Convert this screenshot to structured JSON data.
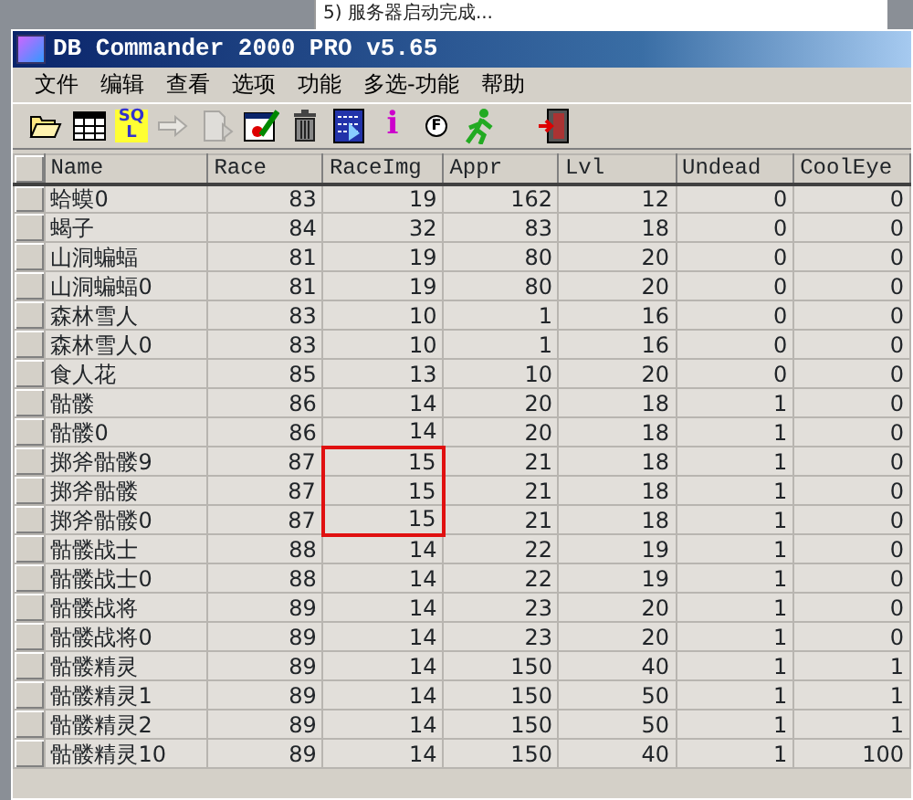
{
  "background_text": "5) 服务器启动完成...",
  "window": {
    "title": "DB Commander 2000 PRO v5.65"
  },
  "menu": [
    "文件",
    "编辑",
    "查看",
    "选项",
    "功能",
    "多选-功能",
    "帮助"
  ],
  "toolbar": [
    {
      "kind": "open",
      "disabled": false
    },
    {
      "kind": "table",
      "disabled": false
    },
    {
      "kind": "sql",
      "label": "SQL",
      "disabled": false
    },
    {
      "kind": "arrow",
      "disabled": true
    },
    {
      "kind": "export",
      "disabled": true
    },
    {
      "kind": "edit",
      "disabled": false
    },
    {
      "kind": "trash",
      "disabled": false
    },
    {
      "kind": "import",
      "disabled": false
    },
    {
      "kind": "info",
      "label": "i",
      "disabled": false
    },
    {
      "kind": "find",
      "label": "F",
      "disabled": false
    },
    {
      "kind": "run",
      "disabled": false
    },
    {
      "kind": "exit",
      "disabled": false
    }
  ],
  "table": {
    "columns": [
      "Name",
      "Race",
      "RaceImg",
      "Appr",
      "Lvl",
      "Undead",
      "CoolEye"
    ],
    "rows": [
      {
        "cells": [
          "蛤蟆0",
          "83",
          "19",
          "162",
          "12",
          "0",
          "0"
        ],
        "marked": false
      },
      {
        "cells": [
          "蝎子",
          "84",
          "32",
          "83",
          "18",
          "0",
          "0"
        ],
        "marked": false
      },
      {
        "cells": [
          "山洞蝙蝠",
          "81",
          "19",
          "80",
          "20",
          "0",
          "0"
        ],
        "marked": false
      },
      {
        "cells": [
          "山洞蝙蝠0",
          "81",
          "19",
          "80",
          "20",
          "0",
          "0"
        ],
        "marked": false
      },
      {
        "cells": [
          "森林雪人",
          "83",
          "10",
          "1",
          "16",
          "0",
          "0"
        ],
        "marked": false
      },
      {
        "cells": [
          "森林雪人0",
          "83",
          "10",
          "1",
          "16",
          "0",
          "0"
        ],
        "marked": false
      },
      {
        "cells": [
          "食人花",
          "85",
          "13",
          "10",
          "20",
          "0",
          "0"
        ],
        "marked": false
      },
      {
        "cells": [
          "骷髅",
          "86",
          "14",
          "20",
          "18",
          "1",
          "0"
        ],
        "marked": false
      },
      {
        "cells": [
          "骷髅0",
          "86",
          "14",
          "20",
          "18",
          "1",
          "0"
        ],
        "marked": false
      },
      {
        "cells": [
          "掷斧骷髅9",
          "87",
          "15",
          "21",
          "18",
          "1",
          "0"
        ],
        "marked": true
      },
      {
        "cells": [
          "掷斧骷髅",
          "87",
          "15",
          "21",
          "18",
          "1",
          "0"
        ],
        "marked": true
      },
      {
        "cells": [
          "掷斧骷髅0",
          "87",
          "15",
          "21",
          "18",
          "1",
          "0"
        ],
        "marked": true
      },
      {
        "cells": [
          "骷髅战士",
          "88",
          "14",
          "22",
          "19",
          "1",
          "0"
        ],
        "marked": false
      },
      {
        "cells": [
          "骷髅战士0",
          "88",
          "14",
          "22",
          "19",
          "1",
          "0"
        ],
        "marked": false
      },
      {
        "cells": [
          "骷髅战将",
          "89",
          "14",
          "23",
          "20",
          "1",
          "0"
        ],
        "marked": false
      },
      {
        "cells": [
          "骷髅战将0",
          "89",
          "14",
          "23",
          "20",
          "1",
          "0"
        ],
        "marked": false
      },
      {
        "cells": [
          "骷髅精灵",
          "89",
          "14",
          "150",
          "40",
          "1",
          "1"
        ],
        "marked": false
      },
      {
        "cells": [
          "骷髅精灵1",
          "89",
          "14",
          "150",
          "50",
          "1",
          "1"
        ],
        "marked": false
      },
      {
        "cells": [
          "骷髅精灵2",
          "89",
          "14",
          "150",
          "50",
          "1",
          "1"
        ],
        "marked": false
      },
      {
        "cells": [
          "骷髅精灵10",
          "89",
          "14",
          "150",
          "40",
          "1",
          "100"
        ],
        "marked": false
      }
    ]
  }
}
